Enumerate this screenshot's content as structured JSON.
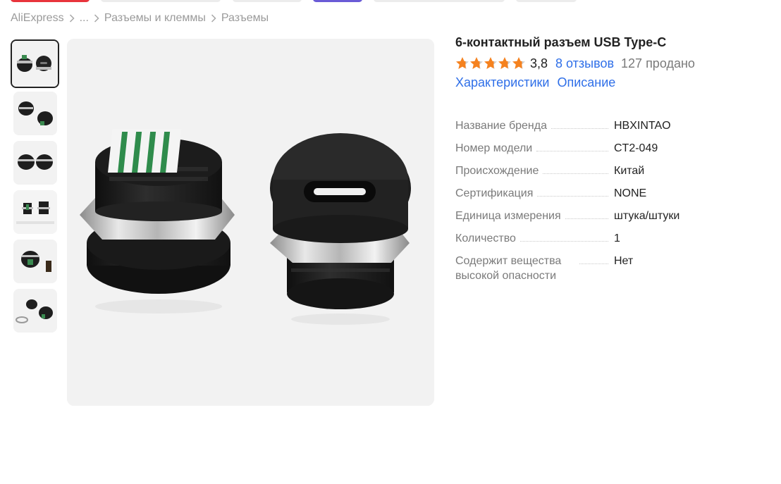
{
  "breadcrumb": [
    "AliExpress",
    "...",
    "Разъемы и клеммы",
    "Разъемы"
  ],
  "product": {
    "title": "6-контактный разъем USB Type-C",
    "rating": "3,8",
    "stars_filled_fraction": 0.76,
    "reviews": "8 отзывов",
    "sold": "127 продано",
    "tabs": [
      "Характеристики",
      "Описание"
    ]
  },
  "specs": [
    {
      "key": "Название бренда",
      "value": "HBXINTAO"
    },
    {
      "key": "Номер модели",
      "value": "CT2-049"
    },
    {
      "key": "Происхождение",
      "value": "Китай"
    },
    {
      "key": "Сертификация",
      "value": "NONE"
    },
    {
      "key": "Единица измерения",
      "value": "штука/штуки"
    },
    {
      "key": "Количество",
      "value": "1"
    },
    {
      "key": "Содержит вещества высокой опасности",
      "value": "Нет"
    }
  ],
  "gallery": {
    "thumbnail_count": 6,
    "active_index": 0,
    "icons": [
      "product-photo",
      "chevron-right-icon",
      "star-icon"
    ]
  },
  "colors": {
    "star": "#f5821f",
    "link": "#2f6fe8",
    "muted": "#7a7a7a"
  }
}
